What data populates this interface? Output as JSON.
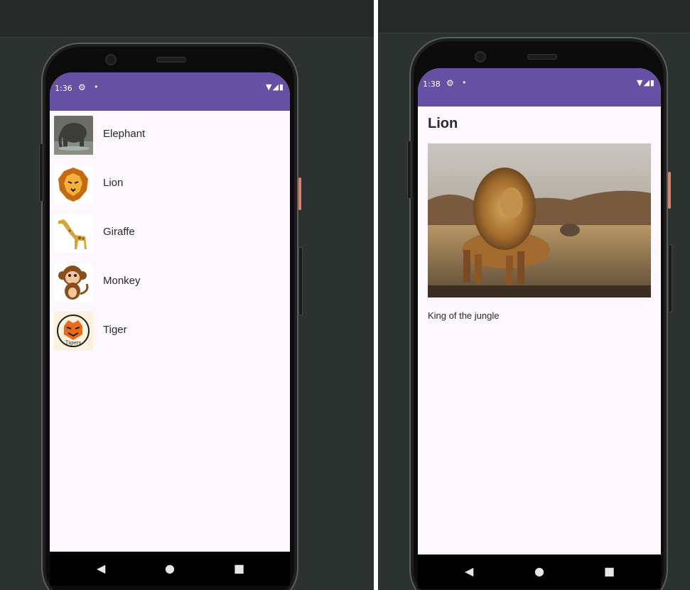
{
  "list_screen": {
    "status": {
      "time": "1:36",
      "gear_icon": "gear-icon",
      "dot": "•",
      "right_icons": "▼◢▮"
    },
    "items": [
      {
        "label": "Elephant",
        "icon": "elephant-icon"
      },
      {
        "label": "Lion",
        "icon": "lion-icon"
      },
      {
        "label": "Giraffe",
        "icon": "giraffe-icon"
      },
      {
        "label": "Monkey",
        "icon": "monkey-icon"
      },
      {
        "label": "Tiger",
        "icon": "tiger-icon",
        "logo_text": "Tigers"
      }
    ],
    "nav": {
      "back": "◀",
      "home": "●",
      "recents": "■"
    }
  },
  "detail_screen": {
    "status": {
      "time": "1:38",
      "gear_icon": "gear-icon",
      "dot": "•",
      "right_icons": "▼◢▮"
    },
    "title": "Lion",
    "description": "King of the jungle",
    "nav": {
      "back": "◀",
      "home": "●",
      "recents": "■"
    }
  },
  "colors": {
    "status_bar": "#6650a4",
    "screen_bg": "#fcf7fd",
    "desktop_bg": "#2c3230"
  }
}
